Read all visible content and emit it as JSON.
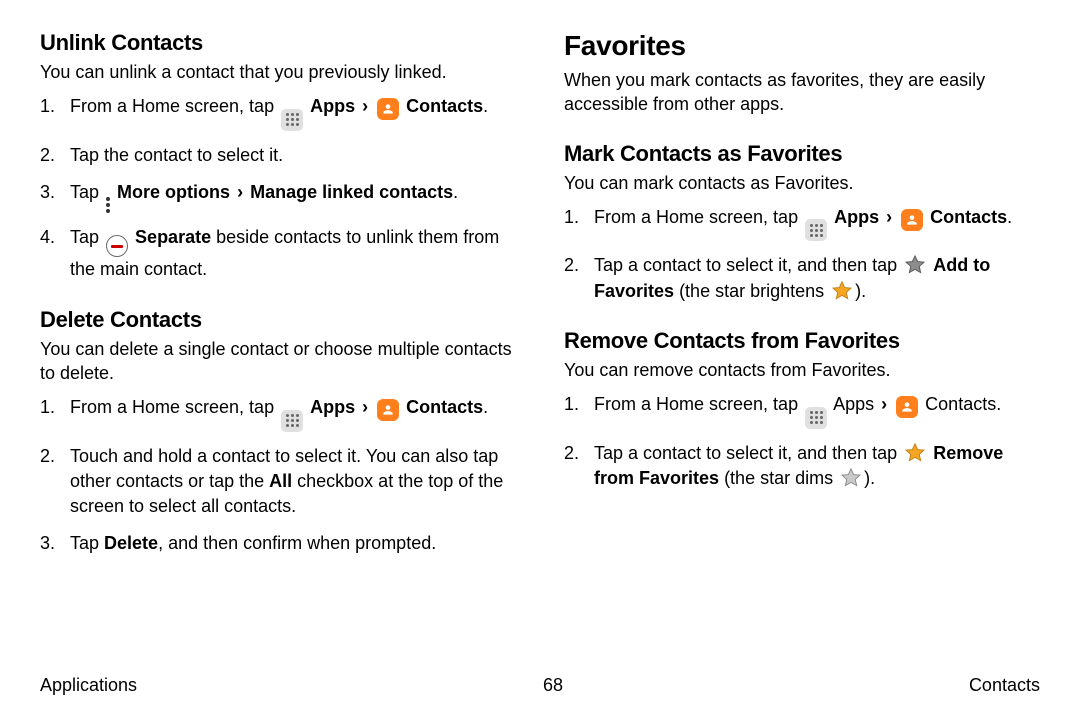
{
  "left": {
    "unlink": {
      "heading": "Unlink Contacts",
      "lede": "You can unlink a contact that you previously linked.",
      "steps": {
        "s1_a": "From a Home screen, tap ",
        "apps": "Apps",
        "contacts": "Contacts",
        "s2": "Tap the contact to select it.",
        "s3_a": "Tap ",
        "s3_b": "More options",
        "s3_c": "Manage linked contacts",
        "s4_a": "Tap ",
        "s4_b": "Separate",
        "s4_c": " beside contacts to unlink them from the main contact."
      }
    },
    "delete": {
      "heading": "Delete Contacts",
      "lede": "You can delete a single contact or choose multiple contacts to delete.",
      "steps": {
        "s1_a": "From a Home screen, tap ",
        "apps": "Apps",
        "contacts": "Contacts",
        "s2_a": "Touch and hold a contact to select it. You can also tap other contacts or tap the ",
        "s2_all": "All",
        "s2_b": " checkbox at the top of the screen to select all contacts.",
        "s3_a": "Tap ",
        "s3_del": "Delete",
        "s3_b": ", and then confirm when prompted."
      }
    }
  },
  "right": {
    "fav": {
      "heading": "Favorites",
      "lede": "When you mark contacts as favorites, they are easily accessible from other apps."
    },
    "mark": {
      "heading": "Mark Contacts as Favorites",
      "lede": "You can mark contacts as Favorites.",
      "steps": {
        "s1_a": "From a Home screen, tap ",
        "apps": "Apps",
        "contacts": "Contacts",
        "s2_a": "Tap a contact to select it, and then tap ",
        "s2_add": "Add to Favorites",
        "s2_b": " (the star brightens ",
        "s2_c": ")."
      }
    },
    "remove": {
      "heading": "Remove Contacts from Favorites",
      "lede": "You can remove contacts from Favorites.",
      "steps": {
        "s1_a": "From a Home screen, tap ",
        "apps": "Apps",
        "contacts": "Contacts",
        "s2_a": "Tap a contact to select it, and then tap ",
        "s2_rem": "Remove from Favorites",
        "s2_b": " (the star dims ",
        "s2_c": ")."
      }
    }
  },
  "footer": {
    "left": "Applications",
    "page": "68",
    "right": "Contacts"
  }
}
